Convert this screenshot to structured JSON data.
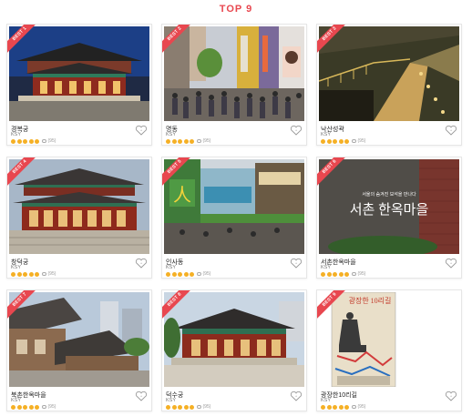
{
  "header": {
    "title": "TOP 9"
  },
  "colors": {
    "accent": "#e8474f",
    "star": "#f5b025"
  },
  "cards": [
    {
      "badge": "BEST 1",
      "name": "경복궁",
      "sub": "KSY",
      "count": "(95)"
    },
    {
      "badge": "BEST 2",
      "name": "명동",
      "sub": "KSY",
      "count": "(95)"
    },
    {
      "badge": "BEST 3",
      "name": "낙산성곽",
      "sub": "KSY",
      "count": "(95)"
    },
    {
      "badge": "BEST 4",
      "name": "창덕궁",
      "sub": "KSY",
      "count": "(95)"
    },
    {
      "badge": "BEST 5",
      "name": "인사동",
      "sub": "KSY",
      "count": "(95)"
    },
    {
      "badge": "BEST 6",
      "name": "서촌한옥마을",
      "sub": "KSY",
      "count": "(95)",
      "overlay_small": "서울의 숨겨진 보석을 만나다",
      "overlay_big": "서촌 한옥마을"
    },
    {
      "badge": "BEST 7",
      "name": "북촌한옥마을",
      "sub": "KSY",
      "count": "(95)"
    },
    {
      "badge": "BEST 8",
      "name": "덕수궁",
      "sub": "KSY",
      "count": "(95)"
    },
    {
      "badge": "BEST 9",
      "name": "광장한10리길",
      "sub": "KSY",
      "count": "(95)",
      "overlay_top": "광장한 10리길"
    }
  ]
}
